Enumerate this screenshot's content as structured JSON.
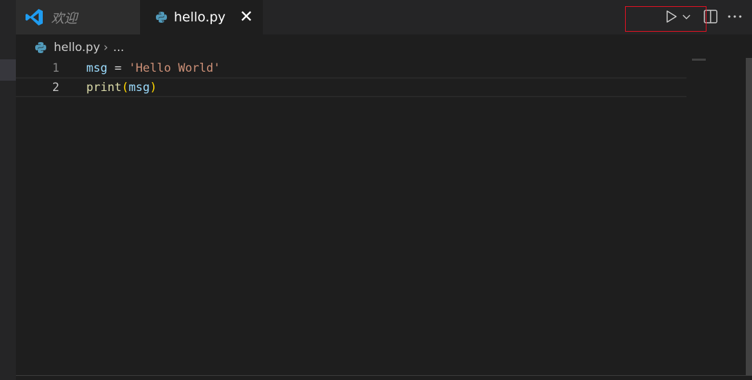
{
  "tabs": [
    {
      "label": "欢迎",
      "icon": "vscode-logo-icon"
    },
    {
      "label": "hello.py",
      "icon": "python-icon",
      "close_symbol": "✕"
    }
  ],
  "actions": {
    "run": "play-icon",
    "run_menu": "chevron-down-icon",
    "split": "split-editor-icon",
    "more": "···"
  },
  "breadcrumb": {
    "file": "hello.py",
    "separator": "›",
    "trail": "..."
  },
  "editor": {
    "lines": [
      {
        "number": "1",
        "tokens": [
          "msg",
          " = ",
          "'Hello World'"
        ]
      },
      {
        "number": "2",
        "tokens": [
          "print",
          "(",
          "msg",
          ")"
        ]
      }
    ]
  },
  "colors": {
    "accent_red": "#e81123",
    "string": "#ce9178",
    "variable": "#9cdcfe",
    "function": "#dcdcaa",
    "bracket": "#ffd700"
  }
}
